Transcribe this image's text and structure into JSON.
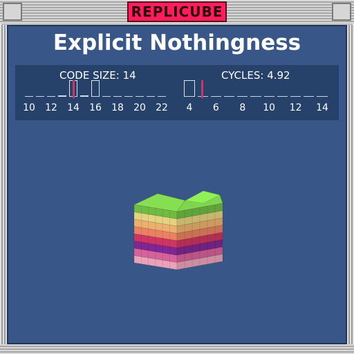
{
  "app": {
    "title": "REPLICUBE"
  },
  "puzzle": {
    "title": "Explicit Nothingness"
  },
  "stats": {
    "code_size": {
      "label": "CODE SIZE: 14",
      "value": 14,
      "axis": {
        "min": 10,
        "max": 22,
        "ticks": [
          "10",
          "12",
          "14",
          "16",
          "18",
          "20",
          "22"
        ]
      },
      "histogram": [
        {
          "bin": 10,
          "count": 0
        },
        {
          "bin": 11,
          "count": 0
        },
        {
          "bin": 12,
          "count": 0
        },
        {
          "bin": 13,
          "count": 0.1
        },
        {
          "bin": 14,
          "count": 1
        },
        {
          "bin": 15,
          "count": 0.1
        },
        {
          "bin": 16,
          "count": 1
        },
        {
          "bin": 17,
          "count": 0
        },
        {
          "bin": 18,
          "count": 0
        },
        {
          "bin": 19,
          "count": 0
        },
        {
          "bin": 20,
          "count": 0
        },
        {
          "bin": 21,
          "count": 0
        },
        {
          "bin": 22,
          "count": 0
        }
      ]
    },
    "cycles": {
      "label": "CYCLES: 4.92",
      "value": 4.92,
      "axis": {
        "min": 4,
        "max": 14,
        "ticks": [
          "4",
          "6",
          "8",
          "10",
          "12",
          "14"
        ]
      },
      "histogram": [
        {
          "bin": 4,
          "count": 1
        },
        {
          "bin": 5,
          "count": 0
        },
        {
          "bin": 6,
          "count": 0
        },
        {
          "bin": 7,
          "count": 0
        },
        {
          "bin": 8,
          "count": 0
        },
        {
          "bin": 9,
          "count": 0
        },
        {
          "bin": 10,
          "count": 0
        },
        {
          "bin": 11,
          "count": 0
        },
        {
          "bin": 12,
          "count": 0
        },
        {
          "bin": 13,
          "count": 0
        },
        {
          "bin": 14,
          "count": 0
        }
      ]
    }
  },
  "model": {
    "layers": [
      "#ffb0c8",
      "#e86aa8",
      "#8c2aa0",
      "#e03a6a",
      "#ff8c6a",
      "#ffbf76",
      "#f7e48a",
      "#7acb4a"
    ]
  },
  "colors": {
    "accent": "#ff1d5a",
    "panel": "#385687",
    "stats_bg": "#26416a"
  }
}
